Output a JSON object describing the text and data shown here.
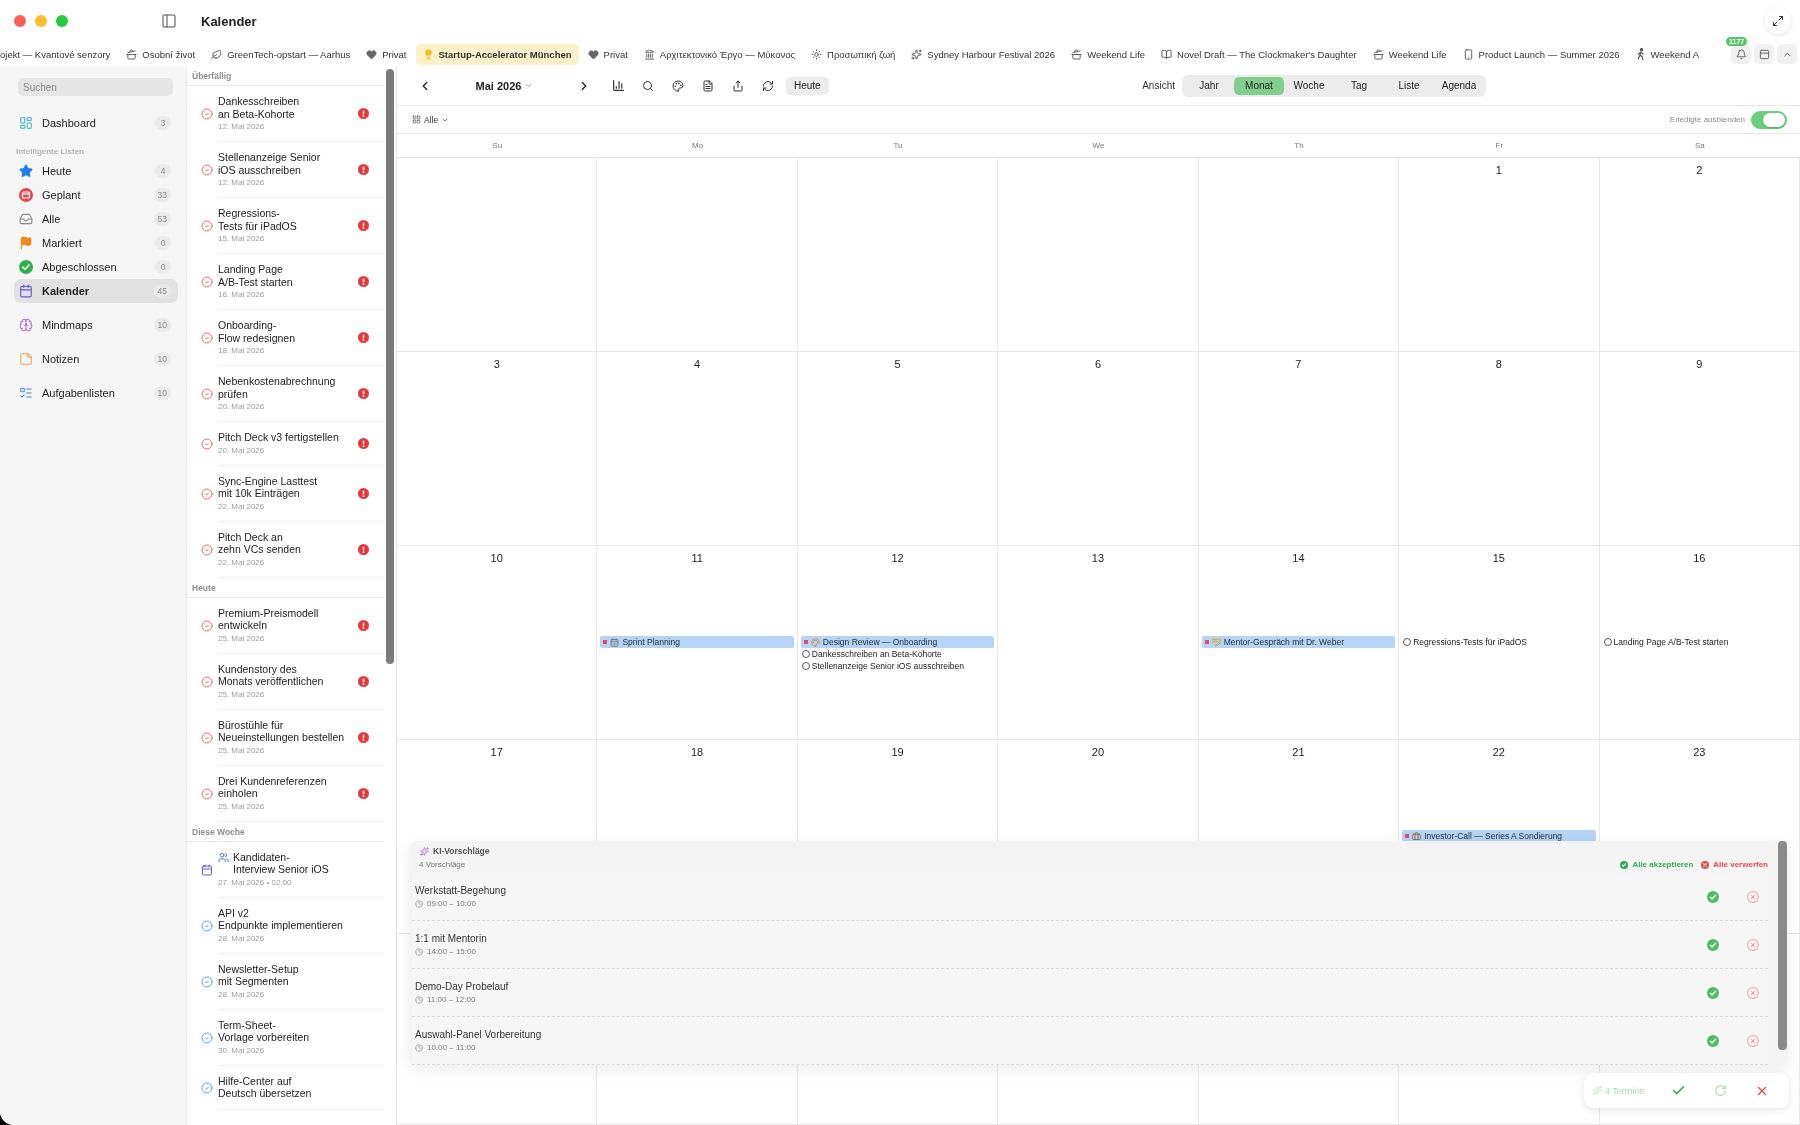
{
  "window": {
    "title": "Kalender"
  },
  "tabs": [
    {
      "label": "ojekt — Kvantové senzory",
      "selected": false
    },
    {
      "label": "Osobní život",
      "kind": "pot",
      "selected": false
    },
    {
      "label": "GreenTech-opstart — Aarhus",
      "kind": "leaf",
      "selected": false
    },
    {
      "label": "Privat",
      "kind": "heart",
      "selected": false
    },
    {
      "label": "Startup-Accelerator München",
      "kind": "bulb",
      "selected": true
    },
    {
      "label": "Privat",
      "kind": "heart",
      "selected": false
    },
    {
      "label": "Αρχιτεκτονικό Έργο — Μύκονος",
      "kind": "buildings",
      "selected": false
    },
    {
      "label": "Προσωπική ζωή",
      "kind": "sun",
      "selected": false
    },
    {
      "label": "Sydney Harbour Festival 2026",
      "kind": "sparkle",
      "selected": false
    },
    {
      "label": "Weekend Life",
      "kind": "pot",
      "selected": false
    },
    {
      "label": "Novel Draft — The Clockmaker's Daughter",
      "kind": "book",
      "selected": false
    },
    {
      "label": "Weekend Life",
      "kind": "pot",
      "selected": false
    },
    {
      "label": "Product Launch — Summer 2026",
      "kind": "phone",
      "selected": false
    },
    {
      "label": "Weekend A",
      "kind": "walker",
      "selected": false
    }
  ],
  "notifications": {
    "badge": "1177"
  },
  "sidebar": {
    "search": {
      "placeholder": "Suchen"
    },
    "groups": [
      {
        "items": [
          {
            "kind": "dashboard",
            "label": "Dashboard",
            "count": "3",
            "selected": false
          }
        ]
      },
      {
        "title": "Intelligente Listen",
        "items": [
          {
            "kind": "today",
            "label": "Heute",
            "count": "4",
            "selected": false
          },
          {
            "kind": "scheduled",
            "label": "Geplant",
            "count": "33",
            "selected": false
          },
          {
            "kind": "all",
            "label": "Alle",
            "count": "53",
            "selected": false
          },
          {
            "kind": "flagged",
            "label": "Markiert",
            "count": "0",
            "selected": false
          },
          {
            "kind": "completed",
            "label": "Abgeschlossen",
            "count": "0",
            "selected": false
          },
          {
            "kind": "calendar",
            "label": "Kalender",
            "count": "45",
            "selected": true
          }
        ]
      },
      {
        "items": [
          {
            "kind": "mindmaps",
            "label": "Mindmaps",
            "count": "10",
            "selected": false
          }
        ]
      },
      {
        "items": [
          {
            "kind": "notes",
            "label": "Notizen",
            "count": "10",
            "selected": false
          }
        ]
      },
      {
        "items": [
          {
            "kind": "tasklists",
            "label": "Aufgabenlisten",
            "count": "10",
            "selected": false
          }
        ]
      }
    ]
  },
  "task_list": {
    "sections": [
      {
        "title": "Überfällig",
        "items": [
          {
            "kind": "task",
            "title": "Dankesschreiben an Beta-Kohorte",
            "date": "12. Mai 2026",
            "overdue": true,
            "high_priority": true
          },
          {
            "kind": "task",
            "title": "Stellenanzeige Senior iOS ausschreiben",
            "date": "12. Mai 2026",
            "overdue": true,
            "high_priority": true
          },
          {
            "kind": "task",
            "title": "Regressions-Tests für iPadOS",
            "date": "15. Mai 2026",
            "overdue": true,
            "high_priority": true
          },
          {
            "kind": "task",
            "title": "Landing Page A/B-Test starten",
            "date": "16. Mai 2026",
            "overdue": true,
            "high_priority": true
          },
          {
            "kind": "task",
            "title": "Onboarding-Flow redesignen",
            "date": "18. Mai 2026",
            "overdue": true,
            "high_priority": true
          },
          {
            "kind": "task",
            "title": "Nebenkostenabrechnung prüfen",
            "date": "20. Mai 2026",
            "overdue": true,
            "high_priority": true
          },
          {
            "kind": "task",
            "title": "Pitch Deck v3 fertigstellen",
            "date": "20. Mai 2026",
            "overdue": true,
            "high_priority": true
          },
          {
            "kind": "task",
            "title": "Sync-Engine Lasttest mit 10k Einträgen",
            "date": "22. Mai 2026",
            "overdue": true,
            "high_priority": true
          },
          {
            "kind": "task",
            "title": "Pitch Deck an zehn VCs senden",
            "date": "22. Mai 2026",
            "overdue": true,
            "high_priority": true
          }
        ]
      },
      {
        "title": "Heute",
        "items": [
          {
            "kind": "task",
            "title": "Premium-Preismodell entwickeln",
            "date": "25. Mai 2026",
            "overdue": true,
            "high_priority": true
          },
          {
            "kind": "task",
            "title": "Kundenstory des Monats veröffentlichen",
            "date": "25. Mai 2026",
            "overdue": true,
            "high_priority": true
          },
          {
            "kind": "task",
            "title": "Bürostühle für Neueinstellungen bestellen",
            "date": "25. Mai 2026",
            "overdue": true,
            "high_priority": true
          },
          {
            "kind": "task",
            "title": "Drei Kundenreferenzen einholen",
            "date": "25. Mai 2026",
            "overdue": true,
            "high_priority": true
          }
        ]
      },
      {
        "title": "Diese Woche",
        "items": [
          {
            "kind": "interview",
            "title": "Kandidaten-Interview Senior iOS",
            "date": "27. Mai 2026 • 02:00",
            "overdue": false,
            "high_priority": false
          },
          {
            "kind": "task",
            "title": "API v2 Endpunkte implementieren",
            "date": "28. Mai 2026",
            "overdue": false,
            "high_priority": false
          },
          {
            "kind": "task",
            "title": "Newsletter-Setup mit Segmenten",
            "date": "28. Mai 2026",
            "overdue": false,
            "high_priority": false
          },
          {
            "kind": "task",
            "title": "Term-Sheet-Vorlage vorbereiten",
            "date": "30. Mai 2026",
            "overdue": false,
            "high_priority": false
          },
          {
            "kind": "task",
            "title": "Hilfe-Center auf Deutsch übersetzen",
            "overdue": false,
            "high_priority": false
          }
        ]
      }
    ]
  },
  "calendar": {
    "month": "Mai 2026",
    "today_button": "Heute",
    "view_label": "Ansicht",
    "views": [
      {
        "label": "Jahr",
        "selected": false
      },
      {
        "label": "Monat",
        "selected": true
      },
      {
        "label": "Woche",
        "selected": false
      },
      {
        "label": "Tag",
        "selected": false
      },
      {
        "label": "Liste",
        "selected": false
      },
      {
        "label": "Agenda",
        "selected": false
      }
    ],
    "filter": {
      "label": "Alle"
    },
    "hide_completed": {
      "label": "Erledigte ausblenden",
      "on": true
    },
    "weekdays": [
      "Su",
      "Mo",
      "Tu",
      "We",
      "Th",
      "Fr",
      "Sa"
    ],
    "weeks": [
      [
        {
          "kind": "blank"
        },
        {
          "kind": "blank"
        },
        {
          "kind": "blank"
        },
        {
          "kind": "blank"
        },
        {
          "kind": "blank"
        },
        {
          "kind": "day",
          "day": "1"
        },
        {
          "kind": "day",
          "day": "2"
        }
      ],
      [
        {
          "kind": "day",
          "day": "3"
        },
        {
          "kind": "day",
          "day": "4"
        },
        {
          "kind": "day",
          "day": "5"
        },
        {
          "kind": "day",
          "day": "6"
        },
        {
          "kind": "day",
          "day": "7"
        },
        {
          "kind": "day",
          "day": "8"
        },
        {
          "kind": "day",
          "day": "9"
        }
      ],
      [
        {
          "kind": "day",
          "day": "10"
        },
        {
          "kind": "day",
          "day": "11",
          "items": [
            {
              "kind": "planning",
              "title": "Sprint Planning"
            }
          ]
        },
        {
          "kind": "day",
          "day": "12",
          "items": [
            {
              "kind": "design",
              "title": "Design Review — Onboarding"
            },
            {
              "kind": "task",
              "title": "Dankesschreiben an Beta-Kohorte"
            },
            {
              "kind": "task",
              "title": "Stellenanzeige Senior iOS ausschreiben"
            }
          ]
        },
        {
          "kind": "day",
          "day": "13"
        },
        {
          "kind": "day",
          "day": "14",
          "items": [
            {
              "kind": "meeting",
              "title": "Mentor-Gespräch mit Dr. Weber"
            }
          ]
        },
        {
          "kind": "day",
          "day": "15",
          "items": [
            {
              "kind": "task",
              "title": "Regressions-Tests für iPadOS"
            }
          ]
        },
        {
          "kind": "day",
          "day": "16",
          "items": [
            {
              "kind": "task",
              "title": "Landing Page A/B-Test starten"
            }
          ]
        }
      ],
      [
        {
          "kind": "day",
          "day": "17"
        },
        {
          "kind": "day",
          "day": "18"
        },
        {
          "kind": "day",
          "day": "19"
        },
        {
          "kind": "day",
          "day": "20"
        },
        {
          "kind": "day",
          "day": "21"
        },
        {
          "kind": "day",
          "day": "22",
          "items": [
            {
              "kind": "business",
              "title": "Investor-Call — Series A Sondierung"
            }
          ]
        },
        {
          "kind": "day",
          "day": "23"
        }
      ],
      [
        {
          "kind": "blank"
        },
        {
          "kind": "blank"
        },
        {
          "kind": "blank"
        },
        {
          "kind": "blank"
        },
        {
          "kind": "blank"
        },
        {
          "kind": "blank"
        },
        {
          "kind": "blank"
        }
      ]
    ]
  },
  "ai_suggestions": {
    "title": "KI-Vorschläge",
    "count_label": "4 Vorschläge",
    "accept_all": "Alle akzeptieren",
    "reject_all": "Alle verwerfen",
    "items": [
      {
        "title": "Werkstatt-Begehung",
        "time": "09:00 – 10:00"
      },
      {
        "title": "1:1 mit Mentorin",
        "time": "14:00 – 15:00"
      },
      {
        "title": "Demo-Day Probelauf",
        "time": "11:00 – 12:00"
      },
      {
        "title": "Auswahl-Panel Vorbereitung",
        "time": "10:00 – 11:00"
      }
    ]
  },
  "pending": {
    "label": "4 Termine"
  }
}
